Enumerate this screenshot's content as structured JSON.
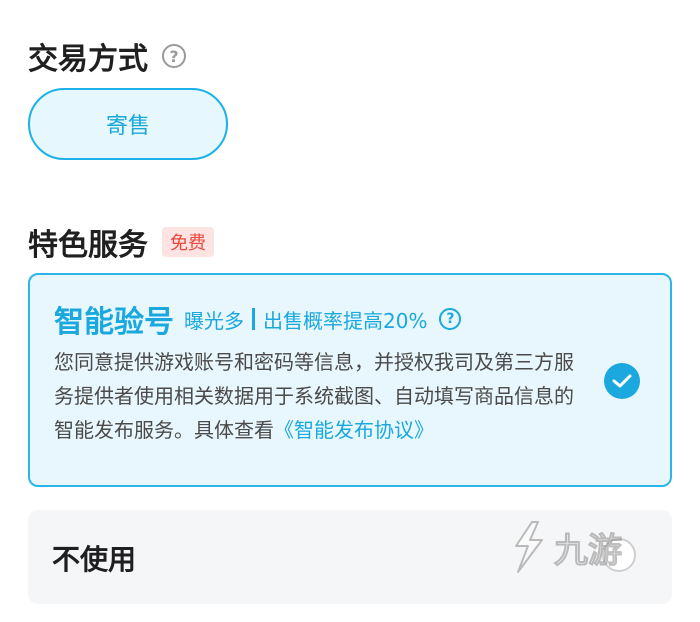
{
  "trade_method": {
    "title": "交易方式",
    "help_icon": "question-circle-icon",
    "option_label": "寄售"
  },
  "special_service": {
    "title": "特色服务",
    "badge": "免费",
    "smart_verify": {
      "title": "智能验号",
      "subtitle_a": "曝光多",
      "subtitle_b": "出售概率提高20%",
      "help_icon": "question-circle-icon",
      "description": "您同意提供游戏账号和密码等信息，并授权我司及第三方服务提供者使用相关数据用于系统截图、自动填写商品信息的智能发布服务。具体查看",
      "agreement_link": "《智能发布协议》",
      "selected": true
    },
    "no_use": {
      "label": "不使用",
      "selected": false
    }
  },
  "watermark": {
    "text": "九游",
    "icon": "jiuyou-logo-icon"
  },
  "colors": {
    "accent": "#1aa8df",
    "badge_red": "#e8483e"
  }
}
